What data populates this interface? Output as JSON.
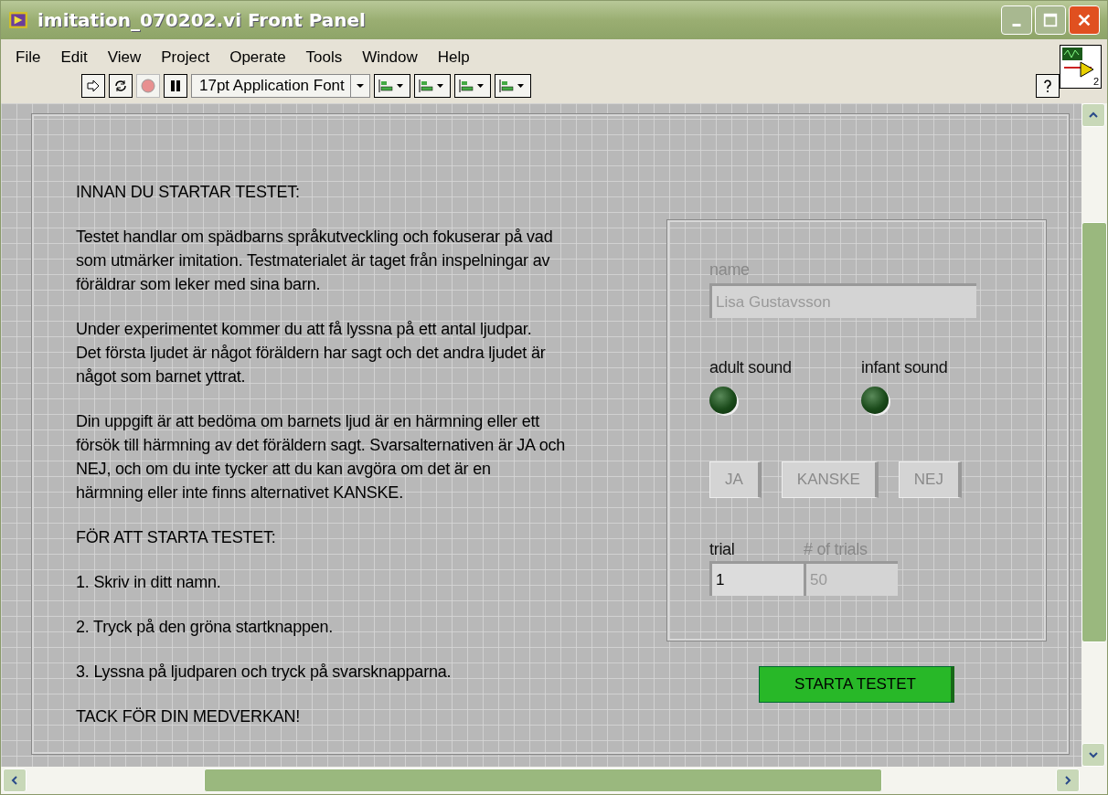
{
  "window": {
    "title": "imitation_070202.vi Front Panel"
  },
  "menu": [
    "File",
    "Edit",
    "View",
    "Project",
    "Operate",
    "Tools",
    "Window",
    "Help"
  ],
  "toolbar": {
    "font": "17pt Application Font",
    "abort_disabled": true,
    "connector_pane_terminal": "2"
  },
  "instructions": [
    [
      "INNAN DU STARTAR TESTET:"
    ],
    [
      "Testet handlar om spädbarns språkutveckling och fokuserar på vad",
      "som utmärker imitation. Testmaterialet är taget från inspelningar av",
      "föräldrar som leker med sina barn."
    ],
    [
      "Under experimentet kommer du att få lyssna på ett antal ljudpar.",
      "Det första ljudet är något föräldern har sagt och det andra ljudet är",
      "något som barnet yttrat."
    ],
    [
      "Din uppgift är att bedöma om barnets ljud är en härmning eller ett",
      "försök till härmning av det föräldern sagt. Svarsalternativen är JA och",
      "NEJ, och om du inte tycker att du kan avgöra om det är en",
      "härmning eller inte finns alternativet KANSKE."
    ],
    [
      "FÖR ATT STARTA TESTET:"
    ],
    [
      "1. Skriv in ditt namn."
    ],
    [
      "2. Tryck på den gröna startknappen."
    ],
    [
      "3. Lyssna på ljudparen och tryck på svarsknapparna."
    ],
    [
      "TACK FÖR DIN MEDVERKAN!"
    ]
  ],
  "name": {
    "label": "name",
    "value": "Lisa Gustavsson",
    "disabled": true
  },
  "leds": [
    {
      "label": "adult sound",
      "on": false
    },
    {
      "label": "infant sound",
      "on": false
    }
  ],
  "answer_buttons": [
    {
      "label": "JA",
      "disabled": true
    },
    {
      "label": "KANSKE",
      "disabled": true
    },
    {
      "label": "NEJ",
      "disabled": true
    }
  ],
  "trial": {
    "label": "trial",
    "value": "1",
    "disabled": false
  },
  "trials": {
    "label": "# of trials",
    "value": "50",
    "disabled": true
  },
  "start_button": {
    "label": "STARTA TESTET"
  }
}
